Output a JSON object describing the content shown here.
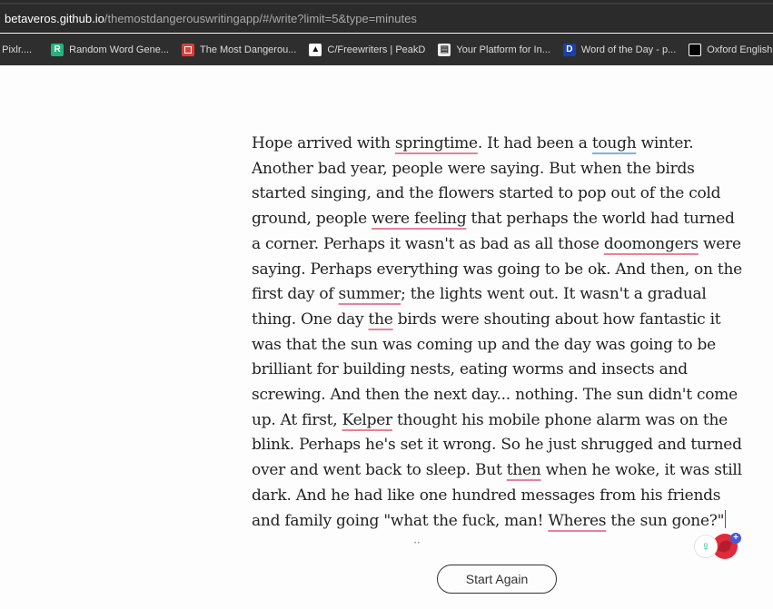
{
  "browser": {
    "url_host": "betaveros.github.io",
    "url_path": "/themostdangerouswritingapp/#/write?limit=5&type=minutes",
    "bookmarks": [
      {
        "label": ": Pixlr....",
        "icon": "none"
      },
      {
        "label": "Random Word Gene...",
        "icon": "r-favicon"
      },
      {
        "label": "The Most Dangerou...",
        "icon": "red-square-favicon"
      },
      {
        "label": "C/Freewriters | PeakD",
        "icon": "peakd-favicon"
      },
      {
        "label": "Your Platform for In...",
        "icon": "b-favicon"
      },
      {
        "label": "Word of the Day - p...",
        "icon": "d-favicon"
      },
      {
        "label": "Oxford English D",
        "icon": "oxford-favicon"
      }
    ]
  },
  "writing": {
    "segments": [
      {
        "t": "Hope arrived with "
      },
      {
        "t": "springtime",
        "u": "sp"
      },
      {
        "t": ". It had been a "
      },
      {
        "t": "tough",
        "u": "gr"
      },
      {
        "t": " winter. Another bad year, people were saying. But when the birds started singing, and the flowers started to pop out of the cold ground, people "
      },
      {
        "t": "were feeling",
        "u": "sp"
      },
      {
        "t": " that perhaps the world had turned a corner. Perhaps it wasn't as bad as all those "
      },
      {
        "t": "doomongers",
        "u": "sp"
      },
      {
        "t": " were saying. Perhaps everything was going to be ok. And then, on the first day of "
      },
      {
        "t": "summer",
        "u": "sp"
      },
      {
        "t": "; the lights went out. It wasn't a gradual thing. One day "
      },
      {
        "t": "the",
        "u": "sp"
      },
      {
        "t": " birds were shouting about how fantastic it was that the sun was coming up and the day was going to be brilliant for building nests, eating worms and insects and screwing. And then the next day... nothing. The sun didn't come up. At first, "
      },
      {
        "t": "Kelper",
        "u": "sp"
      },
      {
        "t": " thought his mobile phone alarm was on the blink. Perhaps he's set it wrong. So he just shrugged and turned over and went back to sleep. But "
      },
      {
        "t": "then",
        "u": "sp"
      },
      {
        "t": " when he woke, it was still dark. And he had like one hundred messages from his friends and family going \"what the fuck, man! "
      },
      {
        "t": "Wheres",
        "u": "sp"
      },
      {
        "t": " the sun gone?\""
      }
    ]
  },
  "footer": {
    "start_again_label": "Start Again"
  },
  "colors": {
    "spelling_underline": "#e7819c",
    "grammar_underline": "#7fb2e6",
    "caret": "#d92020"
  }
}
